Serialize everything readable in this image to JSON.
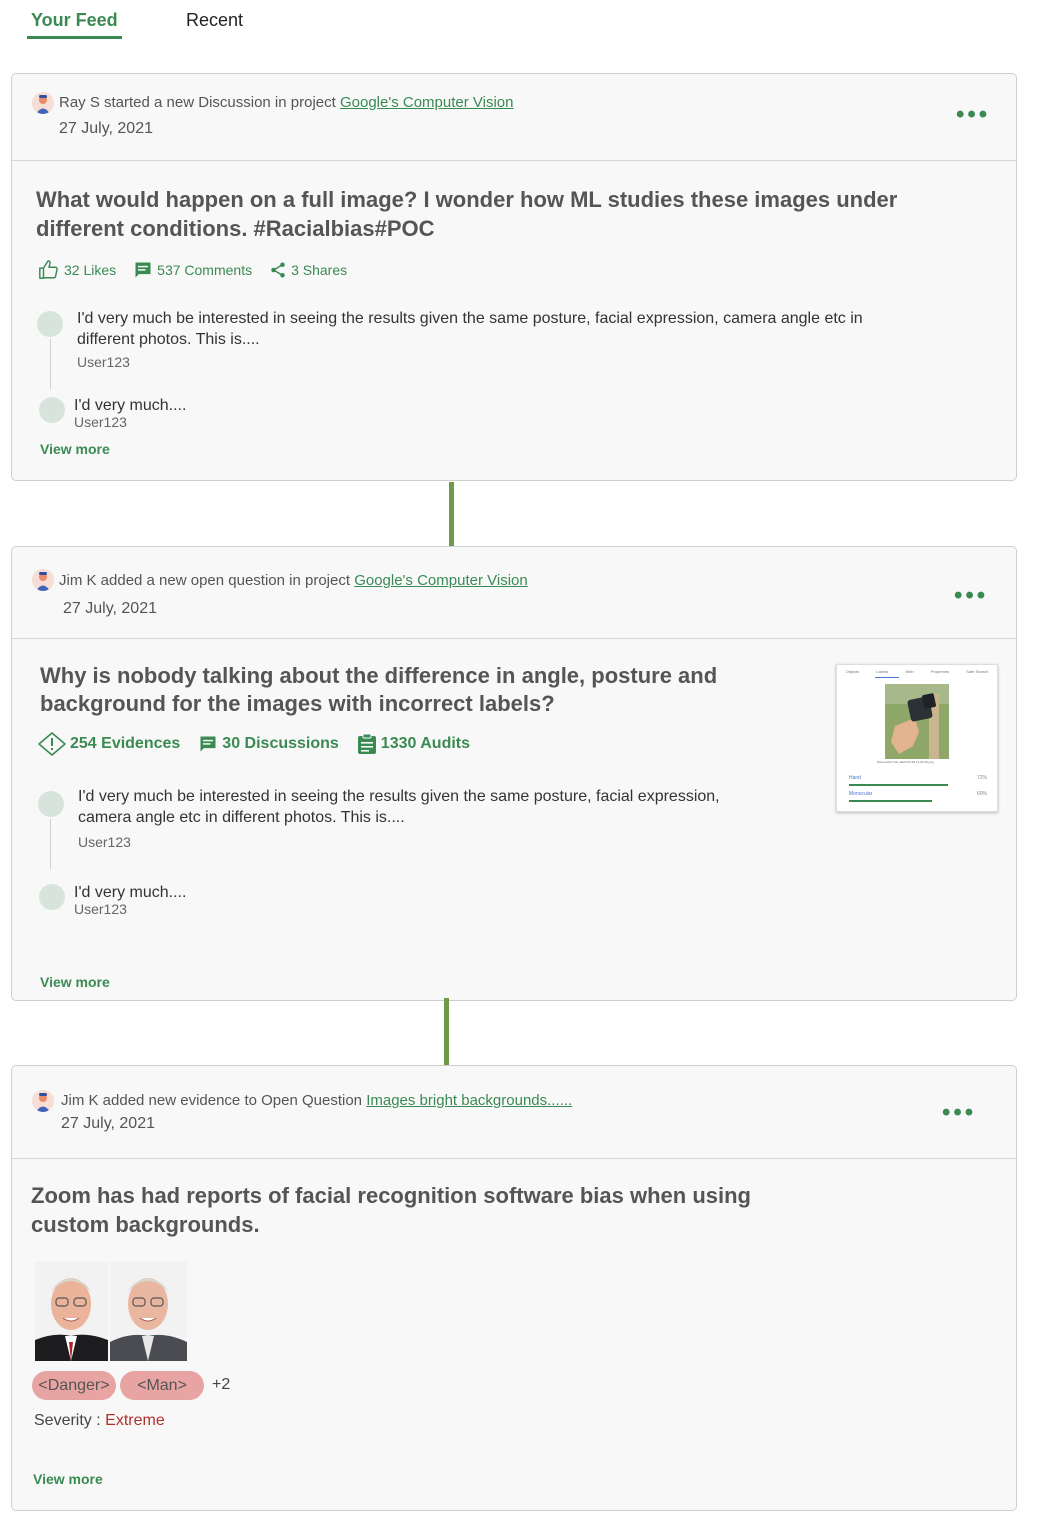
{
  "tabs": [
    {
      "label": "Your Feed",
      "active": true
    },
    {
      "label": "Recent",
      "active": false
    }
  ],
  "colors": {
    "accent": "#3a8a52",
    "connector": "#6f9a4a",
    "tag": "#e8a4a3",
    "severity": "#b0302b"
  },
  "posts": [
    {
      "header_text": "Ray S started a new Discussion in project",
      "header_link": "Google's Computer Vision",
      "date": "27 July, 2021",
      "title": "What would happen on a full image? I wonder how ML studies these images under different conditions. #Racialbias#POC",
      "stats": [
        {
          "icon": "thumbs-up-icon",
          "label": "32 Likes"
        },
        {
          "icon": "comment-icon",
          "label": "537 Comments"
        },
        {
          "icon": "share-icon",
          "label": "3 Shares"
        }
      ],
      "comments": [
        {
          "text": "I'd very much be interested in seeing the results given the same posture, facial expression, camera angle etc in different photos. This is....",
          "user": "User123"
        },
        {
          "text": "I'd very much....",
          "user": "User123"
        }
      ],
      "view_more": "View more"
    },
    {
      "header_text": "Jim K added a new open question in project",
      "header_link": "Google's Computer Vision",
      "date": "27 July, 2021",
      "title": "Why is nobody talking about the difference in angle, posture and background for the images with incorrect labels?",
      "stats": [
        {
          "icon": "alert-icon",
          "label": "254 Evidences"
        },
        {
          "icon": "discussion-icon",
          "label": "30 Discussions"
        },
        {
          "icon": "clipboard-icon",
          "label": "1330 Audits"
        }
      ],
      "comments": [
        {
          "text": "I'd very much be interested in seeing the results given the same posture, facial expression, camera angle etc in different photos. This is....",
          "user": "User123"
        },
        {
          "text": "I'd very much....",
          "user": "User123"
        }
      ],
      "thumbnail": {
        "tabs": [
          "Objects",
          "Labels",
          "Web",
          "Properties",
          "Safe Search"
        ],
        "caption": "Screenshot from 2020-04-02 11-01-45.png",
        "rows": [
          {
            "label": "Hand",
            "pct": "72%",
            "value": 0.72
          },
          {
            "label": "Monocular",
            "pct": "60%",
            "value": 0.6
          }
        ]
      },
      "view_more": "View more"
    },
    {
      "header_text": "Jim K added new evidence to Open Question",
      "header_link": "Images bright backgrounds......",
      "date": "27 July, 2021",
      "title": "Zoom has had reports of facial recognition software bias when using custom backgrounds.",
      "tags": [
        "<Danger>",
        "<Man>"
      ],
      "tags_more": "+2",
      "severity_label": "Severity : ",
      "severity_value": "Extreme",
      "view_more": "View more"
    }
  ]
}
